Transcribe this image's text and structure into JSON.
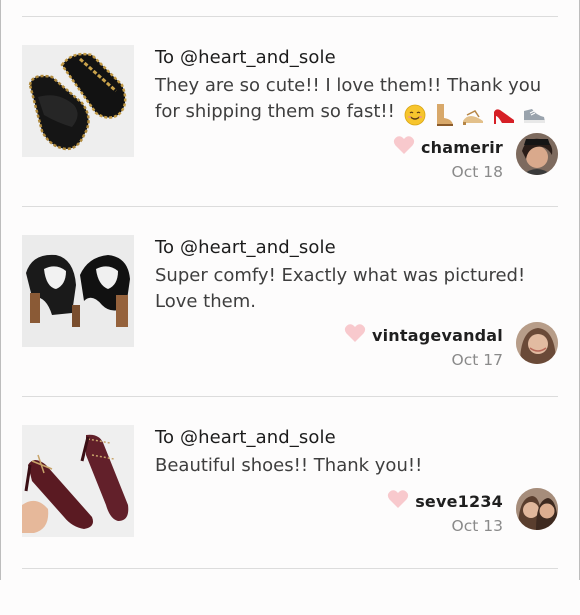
{
  "reviews": [
    {
      "to": "To @heart_and_sole",
      "message": "They are so cute!! I love them!! Thank you for shipping them so fast!!",
      "emojis": [
        "smiling-face-icon",
        "boot-icon",
        "sandal-icon",
        "high-heel-icon",
        "sneaker-icon"
      ],
      "username": "chamerir",
      "date": "Oct 18"
    },
    {
      "to": "To @heart_and_sole",
      "message": "Super comfy! Exactly what was pictured! Love them.",
      "username": "vintagevandal",
      "date": "Oct 17"
    },
    {
      "to": "To @heart_and_sole",
      "message": "Beautiful shoes!! Thank you!!",
      "username": "seve1234",
      "date": "Oct 13"
    }
  ],
  "colors": {
    "heart": "#f8c9cd",
    "divider": "#dcdcdc",
    "username": "#1f1f1f",
    "date": "#8a8a8a",
    "text": "#3e3e3e"
  }
}
